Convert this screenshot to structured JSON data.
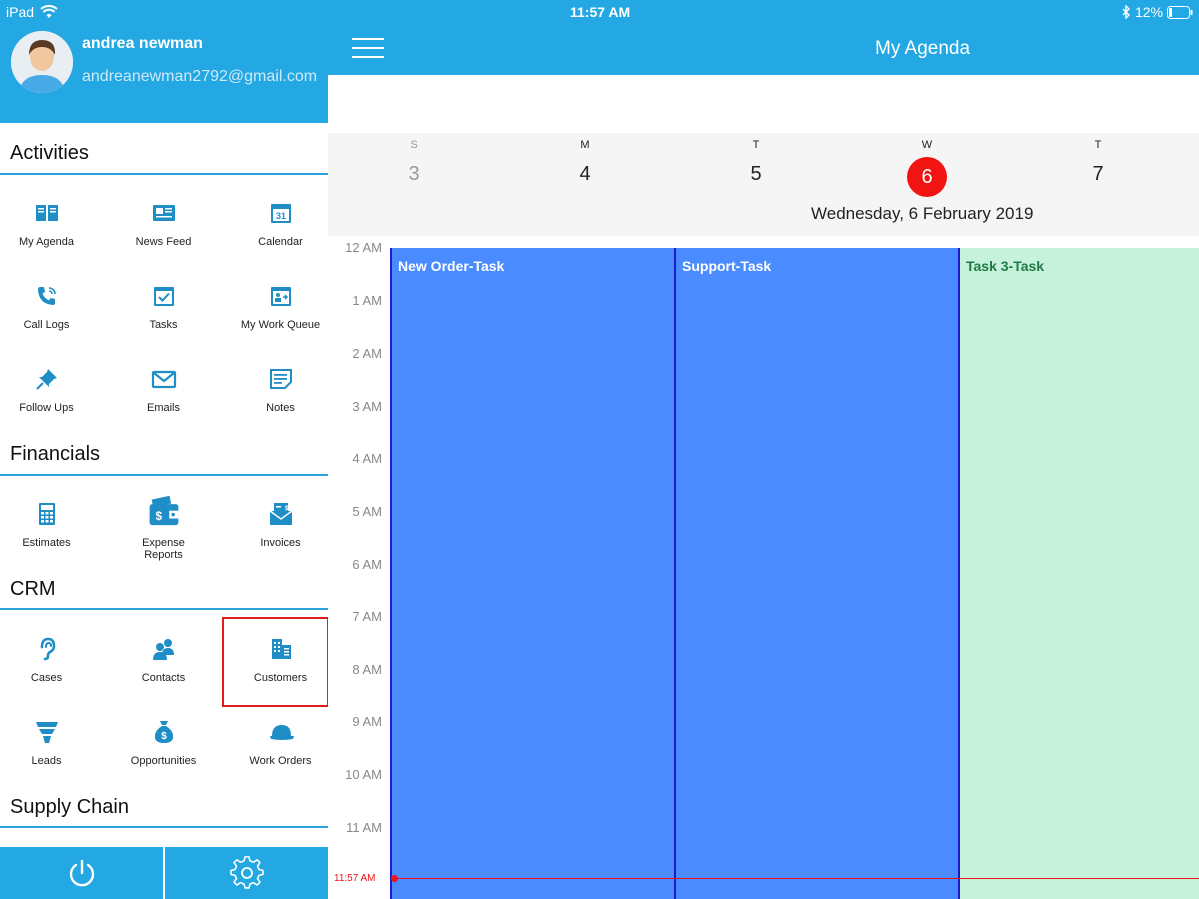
{
  "status_bar": {
    "device": "iPad",
    "time": "11:57 AM",
    "battery": "12%"
  },
  "user": {
    "name": "andrea newman",
    "email": "andreanewman2792@gmail.com"
  },
  "sections": {
    "activities": {
      "title": "Activities",
      "items": [
        {
          "label": "My Agenda",
          "icon": "book-icon"
        },
        {
          "label": "News Feed",
          "icon": "newspaper-icon"
        },
        {
          "label": "Calendar",
          "icon": "calendar-icon",
          "badge": "31"
        },
        {
          "label": "Call Logs",
          "icon": "phone-icon"
        },
        {
          "label": "Tasks",
          "icon": "checkbox-calendar-icon"
        },
        {
          "label": "My Work Queue",
          "icon": "work-queue-icon"
        },
        {
          "label": "Follow Ups",
          "icon": "pin-icon"
        },
        {
          "label": "Emails",
          "icon": "envelope-icon"
        },
        {
          "label": "Notes",
          "icon": "notes-icon"
        }
      ]
    },
    "financials": {
      "title": "Financials",
      "items": [
        {
          "label": "Estimates",
          "icon": "calculator-icon"
        },
        {
          "label": "Expense\nReports",
          "icon": "wallet-icon"
        },
        {
          "label": "Invoices",
          "icon": "invoice-envelope-icon"
        }
      ]
    },
    "crm": {
      "title": "CRM",
      "items": [
        {
          "label": "Cases",
          "icon": "ear-icon"
        },
        {
          "label": "Contacts",
          "icon": "people-icon"
        },
        {
          "label": "Customers",
          "icon": "building-icon"
        },
        {
          "label": "Leads",
          "icon": "funnel-icon"
        },
        {
          "label": "Opportunities",
          "icon": "money-bag-icon"
        },
        {
          "label": "Work Orders",
          "icon": "cap-icon"
        }
      ]
    },
    "supply_chain": {
      "title": "Supply Chain"
    }
  },
  "footer": {
    "power": "power-icon",
    "settings": "gear-icon"
  },
  "main": {
    "title": "My Agenda",
    "week": [
      {
        "letter": "S",
        "num": "3"
      },
      {
        "letter": "M",
        "num": "4"
      },
      {
        "letter": "T",
        "num": "5"
      },
      {
        "letter": "W",
        "num": "6"
      },
      {
        "letter": "T",
        "num": "7"
      }
    ],
    "date_caption": "Wednesday, 6 February 2019",
    "hours": [
      "12 AM",
      "1 AM",
      "2 AM",
      "3 AM",
      "4 AM",
      "5 AM",
      "6 AM",
      "7 AM",
      "8 AM",
      "9 AM",
      "10 AM",
      "11 AM"
    ],
    "now_label": "11:57 AM",
    "events": [
      {
        "title": "New Order-Task",
        "color": "#4a8cff",
        "border": "#1b1bcc",
        "text_color": "#ffffff"
      },
      {
        "title": "Support-Task",
        "color": "#4a8cff",
        "border": "#1b1bcc",
        "text_color": "#ffffff"
      },
      {
        "title": "Task 3-Task",
        "color": "#c6f2dc",
        "border": "#1b1bcc",
        "text_color": "#1e7a44"
      }
    ]
  },
  "colors": {
    "header_blue": "#23a8e4",
    "accent_red": "#f21313",
    "icon_blue": "#1f8ec6"
  }
}
